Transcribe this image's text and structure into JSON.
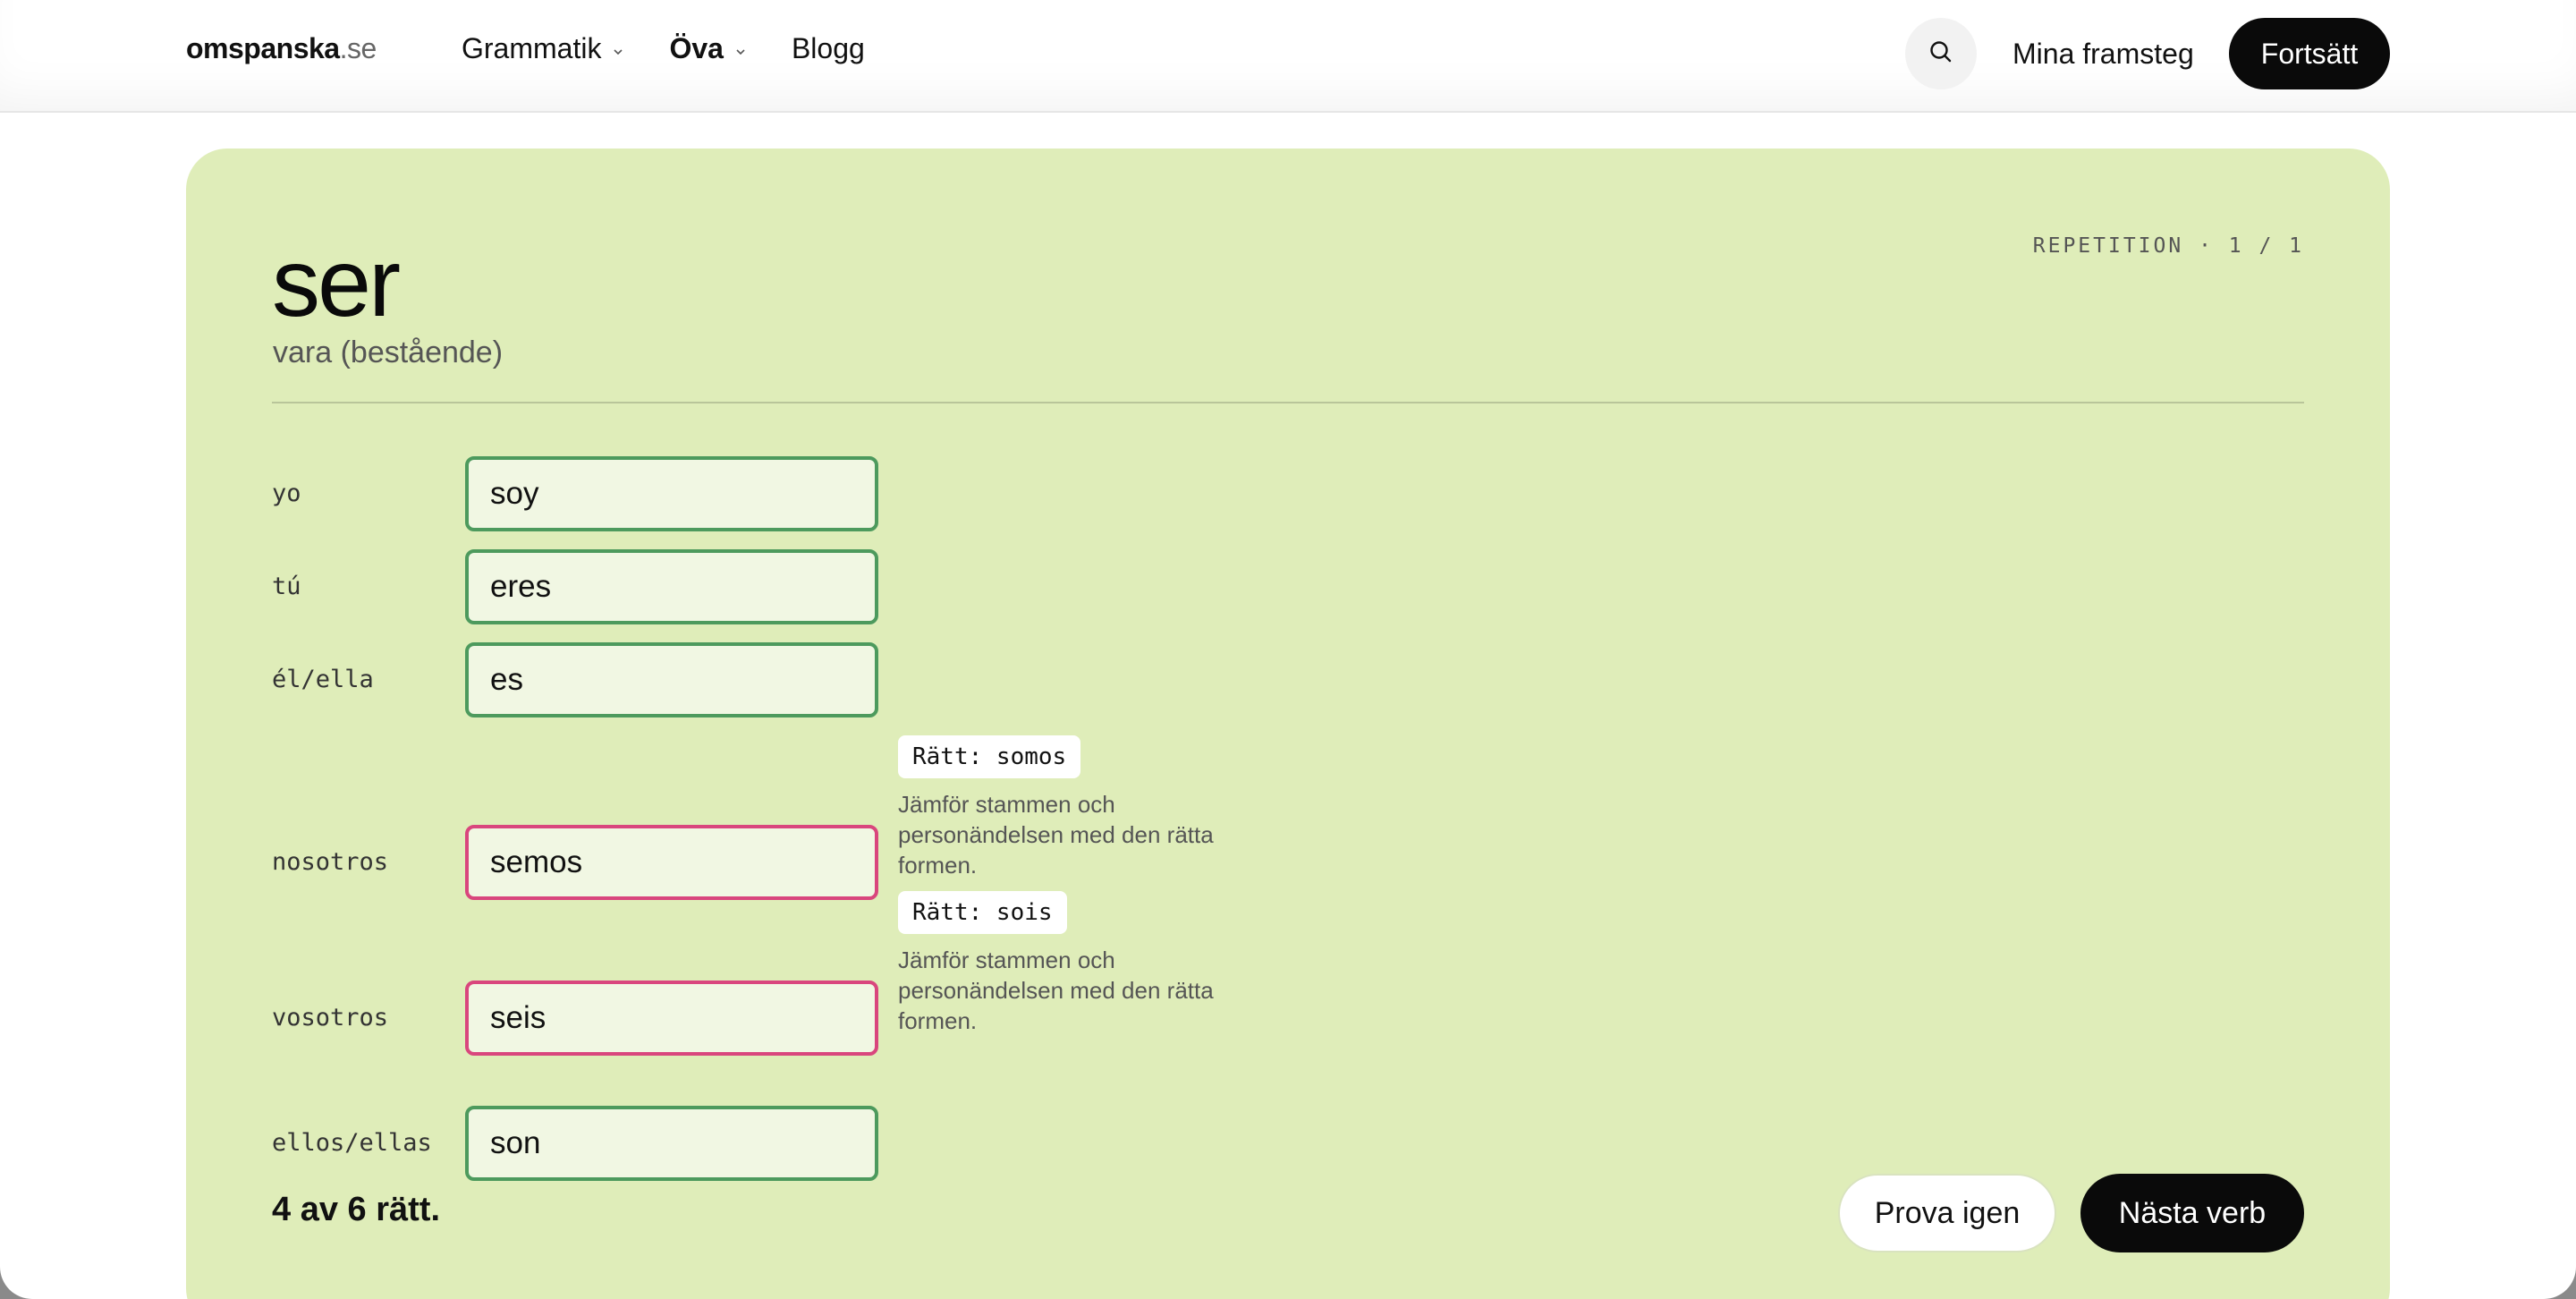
{
  "header": {
    "logo_name": "omspanska",
    "logo_tld": ".se",
    "nav": [
      {
        "label": "Grammatik",
        "has_dropdown": true
      },
      {
        "label": "Öva",
        "has_dropdown": true,
        "active": true
      },
      {
        "label": "Blogg",
        "has_dropdown": false
      }
    ],
    "search_icon": "search-icon",
    "progress_link": "Mina framsteg",
    "continue_label": "Fortsätt"
  },
  "exercise": {
    "verb": "ser",
    "meaning": "vara (bestående)",
    "counter": "REPETITION · 1 / 1",
    "rows": [
      {
        "pronoun": "yo",
        "answer": "soy",
        "status": "correct"
      },
      {
        "pronoun": "tú",
        "answer": "eres",
        "status": "correct"
      },
      {
        "pronoun": "él/ella",
        "answer": "es",
        "status": "correct"
      },
      {
        "pronoun": "nosotros",
        "answer": "semos",
        "status": "wrong",
        "correction": "Rätt: somos",
        "hint": "Jämför stammen och personändelsen med den rätta formen."
      },
      {
        "pronoun": "vosotros",
        "answer": "seis",
        "status": "wrong",
        "correction": "Rätt: sois",
        "hint": "Jämför stammen och personändelsen med den rätta formen."
      },
      {
        "pronoun": "ellos/ellas",
        "answer": "son",
        "status": "correct"
      }
    ],
    "score": "4 av 6 rätt.",
    "retry_label": "Prova igen",
    "next_label": "Nästa verb"
  },
  "colors": {
    "card_bg": "#dfedb9",
    "correct_border": "#4d9a5d",
    "wrong_border": "#d9467d",
    "primary_button": "#0a0a0a"
  }
}
